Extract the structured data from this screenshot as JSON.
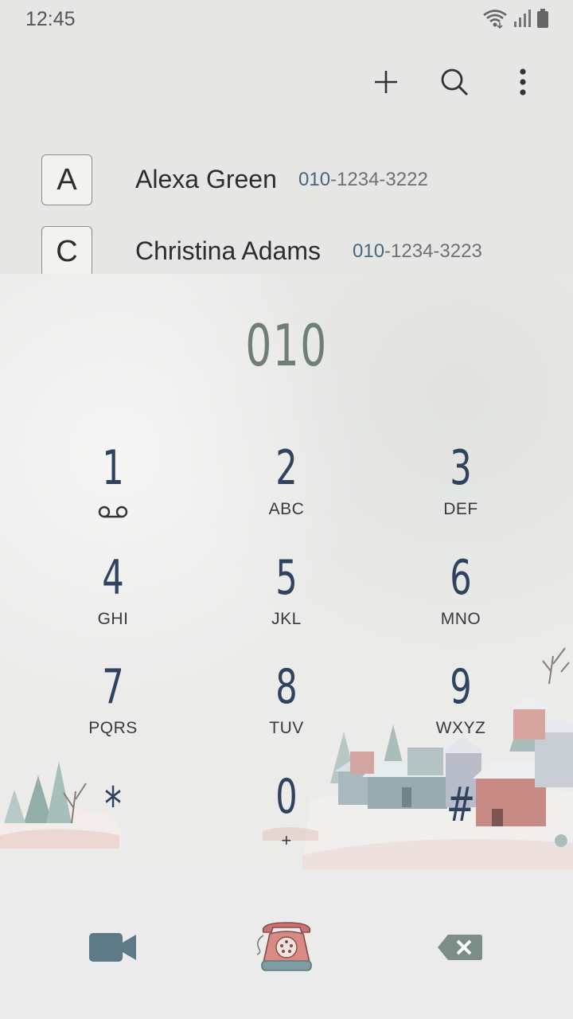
{
  "status": {
    "time": "12:45",
    "icons": [
      "wifi-icon",
      "signal-icon",
      "battery-icon"
    ]
  },
  "toolbar": {
    "add_icon": "plus-icon",
    "search_icon": "search-icon",
    "more_icon": "more-vert-icon"
  },
  "contacts": [
    {
      "letter": "A",
      "name": "Alexa Green",
      "number_match": "010",
      "number_rest": "-1234-3222"
    },
    {
      "letter": "C",
      "name": "Christina Adams",
      "number_match": "010",
      "number_rest": "-1234-3223"
    }
  ],
  "dialer": {
    "input": "010",
    "keys": [
      {
        "digit": "1",
        "letters": "",
        "icon": "voicemail-icon"
      },
      {
        "digit": "2",
        "letters": "ABC"
      },
      {
        "digit": "3",
        "letters": "DEF"
      },
      {
        "digit": "4",
        "letters": "GHI"
      },
      {
        "digit": "5",
        "letters": "JKL"
      },
      {
        "digit": "6",
        "letters": "MNO"
      },
      {
        "digit": "7",
        "letters": "PQRS"
      },
      {
        "digit": "8",
        "letters": "TUV"
      },
      {
        "digit": "9",
        "letters": "WXYZ"
      },
      {
        "digit": "*",
        "letters": ""
      },
      {
        "digit": "0",
        "letters": "+"
      },
      {
        "digit": "#",
        "letters": ""
      }
    ]
  },
  "actions": {
    "video_icon": "video-call-icon",
    "call_icon": "phone-call-icon",
    "delete_icon": "backspace-icon"
  },
  "colors": {
    "digit": "#2f4360",
    "dialed": "#6f7f73",
    "highlight": "#4a6582",
    "video": "#5c7a86",
    "delete": "#7c8c88"
  }
}
